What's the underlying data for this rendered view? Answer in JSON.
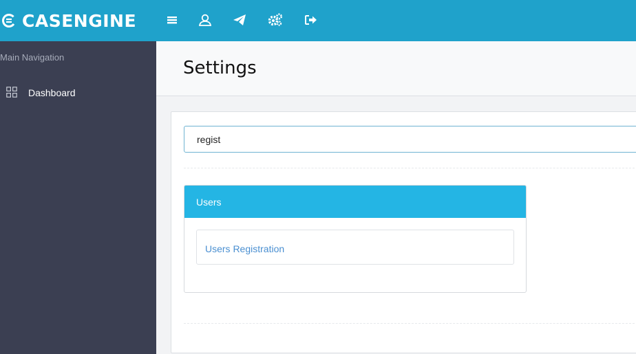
{
  "app": {
    "brand": "CASENGINE"
  },
  "topbar": {
    "icons": [
      "menu-icon",
      "user-icon",
      "paper-plane-icon",
      "gears-icon",
      "sign-out-icon"
    ]
  },
  "sidebar": {
    "heading": "Main Navigation",
    "items": [
      {
        "label": "Dashboard",
        "icon": "grid-icon"
      }
    ]
  },
  "page": {
    "title": "Settings"
  },
  "search": {
    "value": "regist"
  },
  "results": {
    "group_title": "Users",
    "items": [
      {
        "label": "Users Registration"
      }
    ]
  },
  "colors": {
    "topbar": "#1fa2cb",
    "sidebar": "#3b3f52",
    "panel_header": "#24b5e4",
    "link": "#4a8fd1"
  }
}
